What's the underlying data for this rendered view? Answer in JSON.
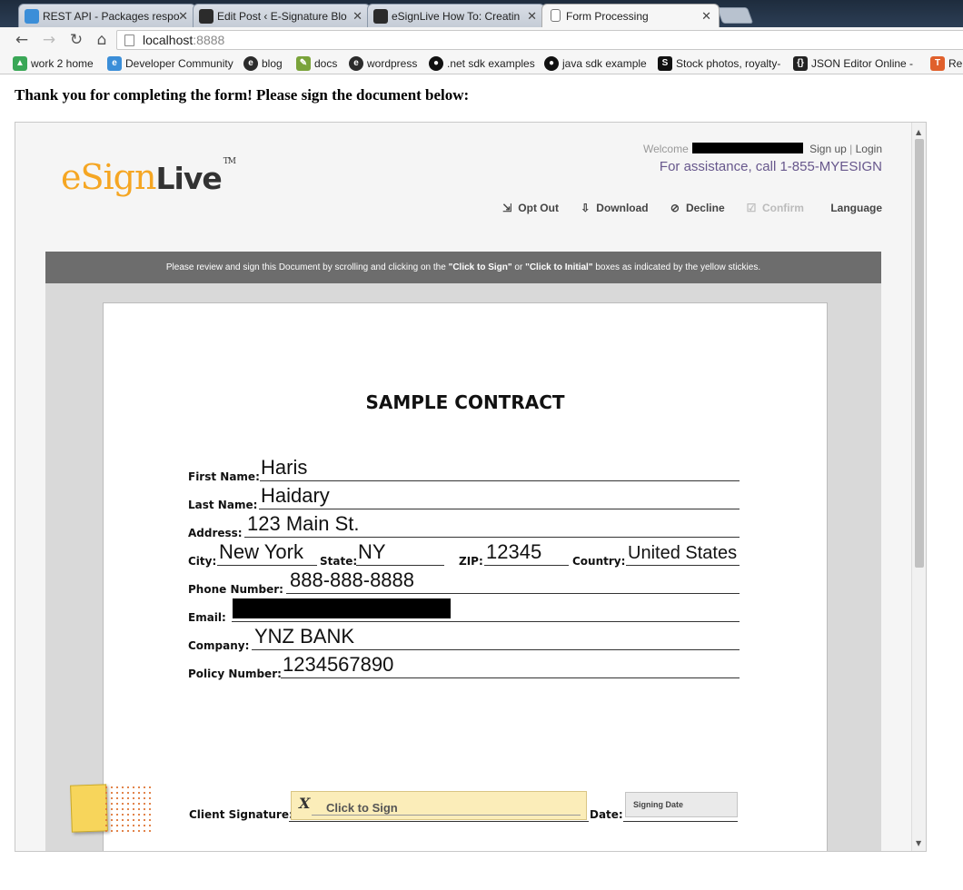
{
  "browser": {
    "tabs": [
      {
        "label": "REST API - Packages respo",
        "icon_color": "#3b8ed8"
      },
      {
        "label": "Edit Post ‹ E-Signature Blo",
        "icon_color": "#2b2b2b"
      },
      {
        "label": "eSignLive How To: Creatin",
        "icon_color": "#2b2b2b"
      },
      {
        "label": "Form Processing",
        "icon_color": "#ffffff"
      }
    ],
    "address": {
      "host": "localhost",
      "port": ":8888"
    },
    "bookmarks": [
      {
        "label": "work 2 home",
        "icon": "map-icon",
        "icon_color": "#3aa757"
      },
      {
        "label": "Developer Community",
        "icon": "esignlive-icon",
        "icon_color": "#3b8ed8"
      },
      {
        "label": "blog",
        "icon": "esignlive-icon",
        "icon_color": "#2b2b2b"
      },
      {
        "label": "docs",
        "icon": "pencil-icon",
        "icon_color": "#7aa33a"
      },
      {
        "label": "wordpress",
        "icon": "esignlive-icon",
        "icon_color": "#2b2b2b"
      },
      {
        "label": ".net sdk examples",
        "icon": "github-icon",
        "icon_color": "#111111"
      },
      {
        "label": "java sdk example",
        "icon": "github-icon",
        "icon_color": "#111111"
      },
      {
        "label": "Stock photos, royalty-",
        "icon": "s-icon",
        "icon_color": "#111111"
      },
      {
        "label": "JSON Editor Online -",
        "icon": "braces-icon",
        "icon_color": "#222222"
      },
      {
        "label": "Re",
        "icon": "t-icon",
        "icon_color": "#e0602c"
      }
    ]
  },
  "page": {
    "heading": "Thank you for completing the form! Please sign the document below:"
  },
  "esign": {
    "logo_e": "e",
    "logo_sign": "Sign",
    "logo_live": "Live",
    "logo_tm": "TM",
    "welcome_prefix": "Welcome",
    "sign_up": "Sign up",
    "separator": "|",
    "login": "Login",
    "assistance": "For assistance, call 1-855-MYESIGN",
    "actions": {
      "opt_out": "Opt Out",
      "download": "Download",
      "decline": "Decline",
      "confirm": "Confirm",
      "language": "Language"
    },
    "notice_pre": "Please review and sign this Document by scrolling and clicking on the ",
    "notice_click_sign": "\"Click to Sign\"",
    "notice_or": " or ",
    "notice_click_initial": "\"Click to Initial\"",
    "notice_post": " boxes as indicated by the yellow stickies."
  },
  "contract": {
    "title": "SAMPLE CONTRACT",
    "first_name": {
      "label": "First Name:",
      "value": "Haris"
    },
    "last_name": {
      "label": "Last Name:",
      "value": "Haidary"
    },
    "address": {
      "label": "Address:",
      "value": "123 Main St."
    },
    "city": {
      "label": "City:",
      "value": "New York"
    },
    "state": {
      "label": "State:",
      "value": "NY"
    },
    "zip": {
      "label": "ZIP:",
      "value": "12345"
    },
    "country": {
      "label": "Country:",
      "value": "United States"
    },
    "phone": {
      "label": "Phone Number:",
      "value": "888-888-8888"
    },
    "email": {
      "label": "Email:"
    },
    "company": {
      "label": "Company:",
      "value": "YNZ BANK"
    },
    "policy": {
      "label": "Policy Number:",
      "value": "1234567890"
    },
    "signature": {
      "label": "Client Signature:",
      "mark": "X",
      "button": "Click to Sign"
    },
    "date": {
      "label": "Date:",
      "placeholder": "Signing Date"
    }
  }
}
